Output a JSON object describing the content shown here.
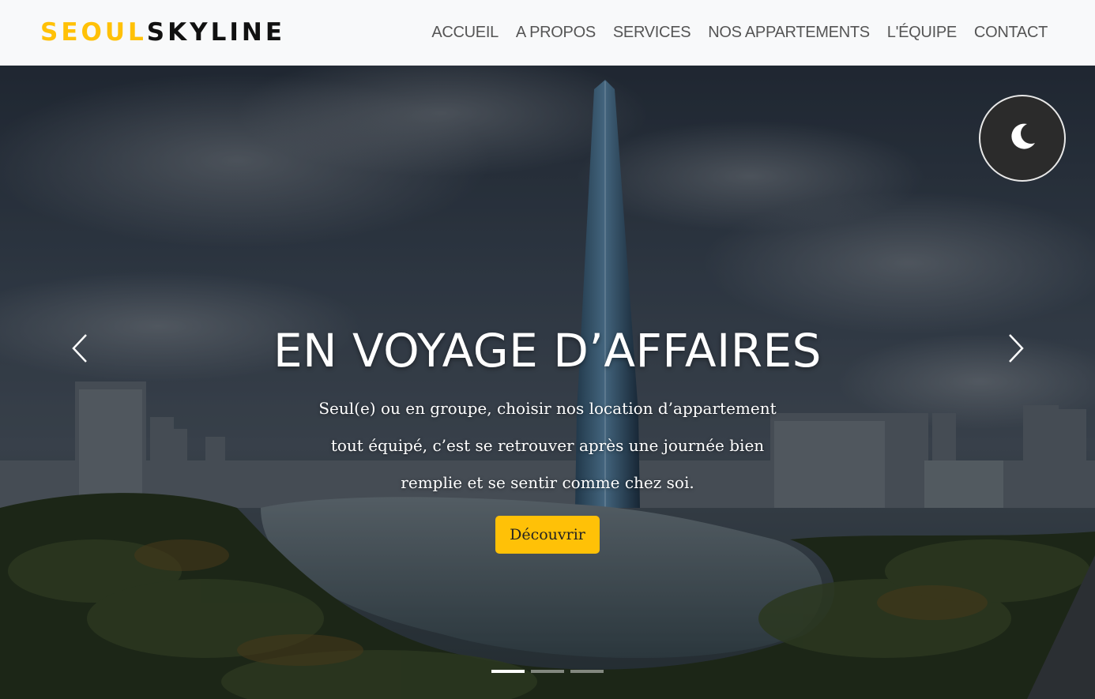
{
  "brand": {
    "part1": "SEOUL",
    "part2": "SKYLINE",
    "accent_color": "#ffc107"
  },
  "nav": {
    "items": [
      {
        "label": "ACCUEIL"
      },
      {
        "label": "A PROPOS"
      },
      {
        "label": "SERVICES"
      },
      {
        "label": "NOS APPARTEMENTS"
      },
      {
        "label": "L'ÉQUIPE"
      },
      {
        "label": "CONTACT"
      }
    ]
  },
  "hero": {
    "title": "EN VOYAGE D’AFFAIRES",
    "text": "Seul(e) ou en groupe, choisir nos location d’appartement tout équipé, c’est se retrouver après une journée bien remplie et se sentir comme chez soi.",
    "cta_label": "Découvrir",
    "theme_toggle_icon": "moon-icon",
    "prev_icon": "chevron-left-icon",
    "next_icon": "chevron-right-icon",
    "slide_count": 3,
    "active_slide": 1
  }
}
